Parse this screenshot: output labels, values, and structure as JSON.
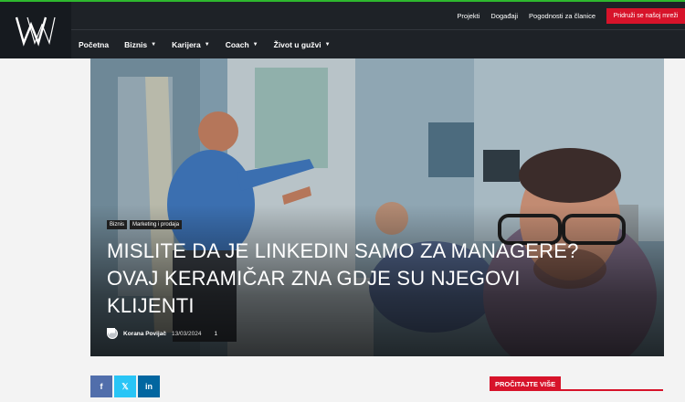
{
  "brand": {
    "logo_text": "VW",
    "accent": "#d7132a",
    "top_accent": "#2eb82e"
  },
  "topbar": {
    "links": [
      "Projekti",
      "Događaji",
      "Pogodnosti za članice"
    ],
    "join_label": "Pridruži se našoj mreži"
  },
  "nav": {
    "items": [
      {
        "label": "Početna",
        "dropdown": false
      },
      {
        "label": "Biznis",
        "dropdown": true
      },
      {
        "label": "Karijera",
        "dropdown": true
      },
      {
        "label": "Coach",
        "dropdown": true
      },
      {
        "label": "Život u gužvi",
        "dropdown": true
      }
    ]
  },
  "article": {
    "tags": [
      "Biznis",
      "Marketing i prodaja"
    ],
    "title": "MISLITE DA JE LINKEDIN SAMO ZA MANAGERE? OVAJ KERAMIČAR ZNA GDJE SU NJEGOVI KLIJENTI",
    "author": "Korana Povijač",
    "date": "13/03/2024",
    "comments": "1"
  },
  "share": [
    {
      "label": "f",
      "icon": "facebook-icon",
      "color": "#516eab"
    },
    {
      "label": "𝕏",
      "icon": "x-icon",
      "color": "#29c5f6"
    },
    {
      "label": "in",
      "icon": "linkedin-icon",
      "color": "#0266a0"
    }
  ],
  "sidebar": {
    "read_more_label": "PROČITAJTE VIŠE"
  }
}
